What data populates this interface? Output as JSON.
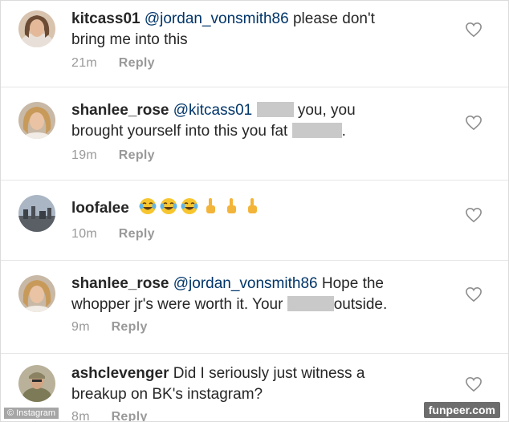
{
  "comments": [
    {
      "username": "kitcass01",
      "mention": "@jordan_vonsmith86",
      "text_line1": "please don't",
      "text_line2": "bring me into this",
      "time": "21m",
      "reply": "Reply"
    },
    {
      "username": "shanlee_rose",
      "mention": "@kitcass01",
      "text_after_blur": "you, you",
      "text_line2": "brought yourself into this you fat",
      "text_end": ".",
      "time": "19m",
      "reply": "Reply"
    },
    {
      "username": "loofalee",
      "emojis": [
        "face-with-tears-of-joy",
        "face-with-tears-of-joy",
        "face-with-tears-of-joy",
        "backhand-index-pointing-up",
        "backhand-index-pointing-up",
        "backhand-index-pointing-up"
      ],
      "time": "10m",
      "reply": "Reply"
    },
    {
      "username": "shanlee_rose",
      "mention": "@jordan_vonsmith86",
      "text_line1": "Hope the",
      "text_line2": "whopper jr's were worth it. Your",
      "text_after_blur": "outside.",
      "time": "9m",
      "reply": "Reply"
    },
    {
      "username": "ashclevenger",
      "text_line1": "Did I seriously just witness a",
      "text_line2": "breakup on BK's instagram?",
      "time": "8m",
      "reply": "Reply"
    }
  ],
  "watermarks": {
    "left": "© Instagram",
    "right": "funpeer.com"
  },
  "colors": {
    "username": "#262626",
    "mention": "#003569",
    "meta": "#999999",
    "censor": "#c9c9c9"
  }
}
